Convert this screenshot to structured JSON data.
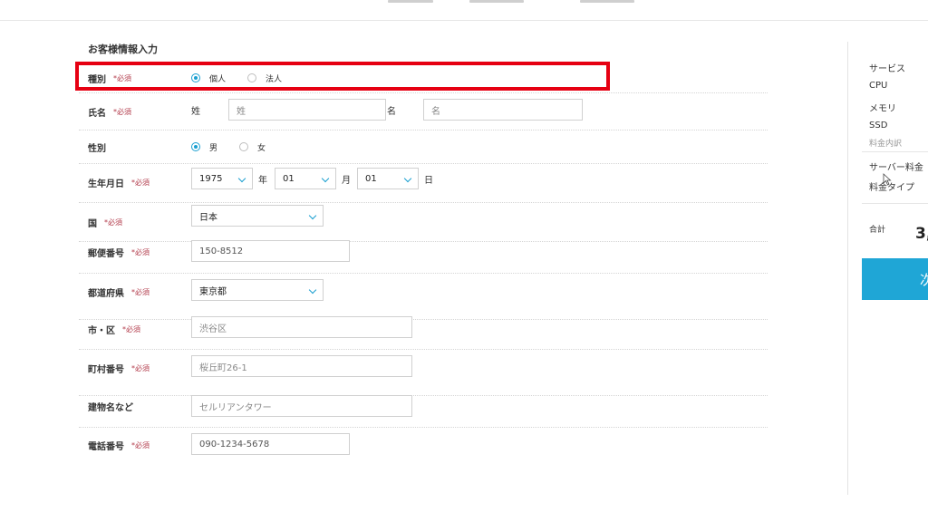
{
  "form": {
    "section_title": "お客様情報入力",
    "required_mark": "*必須",
    "type": {
      "label": "種別",
      "options": [
        {
          "label": "個人",
          "selected": true
        },
        {
          "label": "法人",
          "selected": false
        }
      ]
    },
    "name": {
      "label": "氏名",
      "last_label": "姓",
      "last_placeholder": "姓",
      "first_label": "名",
      "first_placeholder": "名"
    },
    "gender": {
      "label": "性別",
      "options": [
        {
          "label": "男",
          "selected": true
        },
        {
          "label": "女",
          "selected": false
        }
      ]
    },
    "birthdate": {
      "label": "生年月日",
      "year": "1975",
      "year_unit": "年",
      "month": "01",
      "month_unit": "月",
      "day": "01",
      "day_unit": "日"
    },
    "country": {
      "label": "国",
      "value": "日本"
    },
    "postal": {
      "label": "郵便番号",
      "value": "150-8512"
    },
    "prefecture": {
      "label": "都道府県",
      "value": "東京都"
    },
    "city": {
      "label": "市・区",
      "placeholder": "渋谷区"
    },
    "town": {
      "label": "町村番号",
      "placeholder": "桜丘町26-1"
    },
    "building": {
      "label": "建物名など",
      "placeholder": "セルリアンタワー"
    },
    "phone": {
      "label": "電話番号",
      "value": "090-1234-5678"
    }
  },
  "sidebar": {
    "items": [
      "サービス",
      "CPU",
      "メモリ",
      "SSD"
    ],
    "breakdown_label": "料金内訳",
    "fee_items": [
      "サーバー料金",
      "料金タイプ"
    ],
    "total_label": "合計",
    "total_value": "3,",
    "next_button": "次"
  },
  "colors": {
    "accent": "#1a9fd0",
    "highlight": "#e60012",
    "required": "#b23a4a",
    "next_button": "#1fa6d6"
  }
}
